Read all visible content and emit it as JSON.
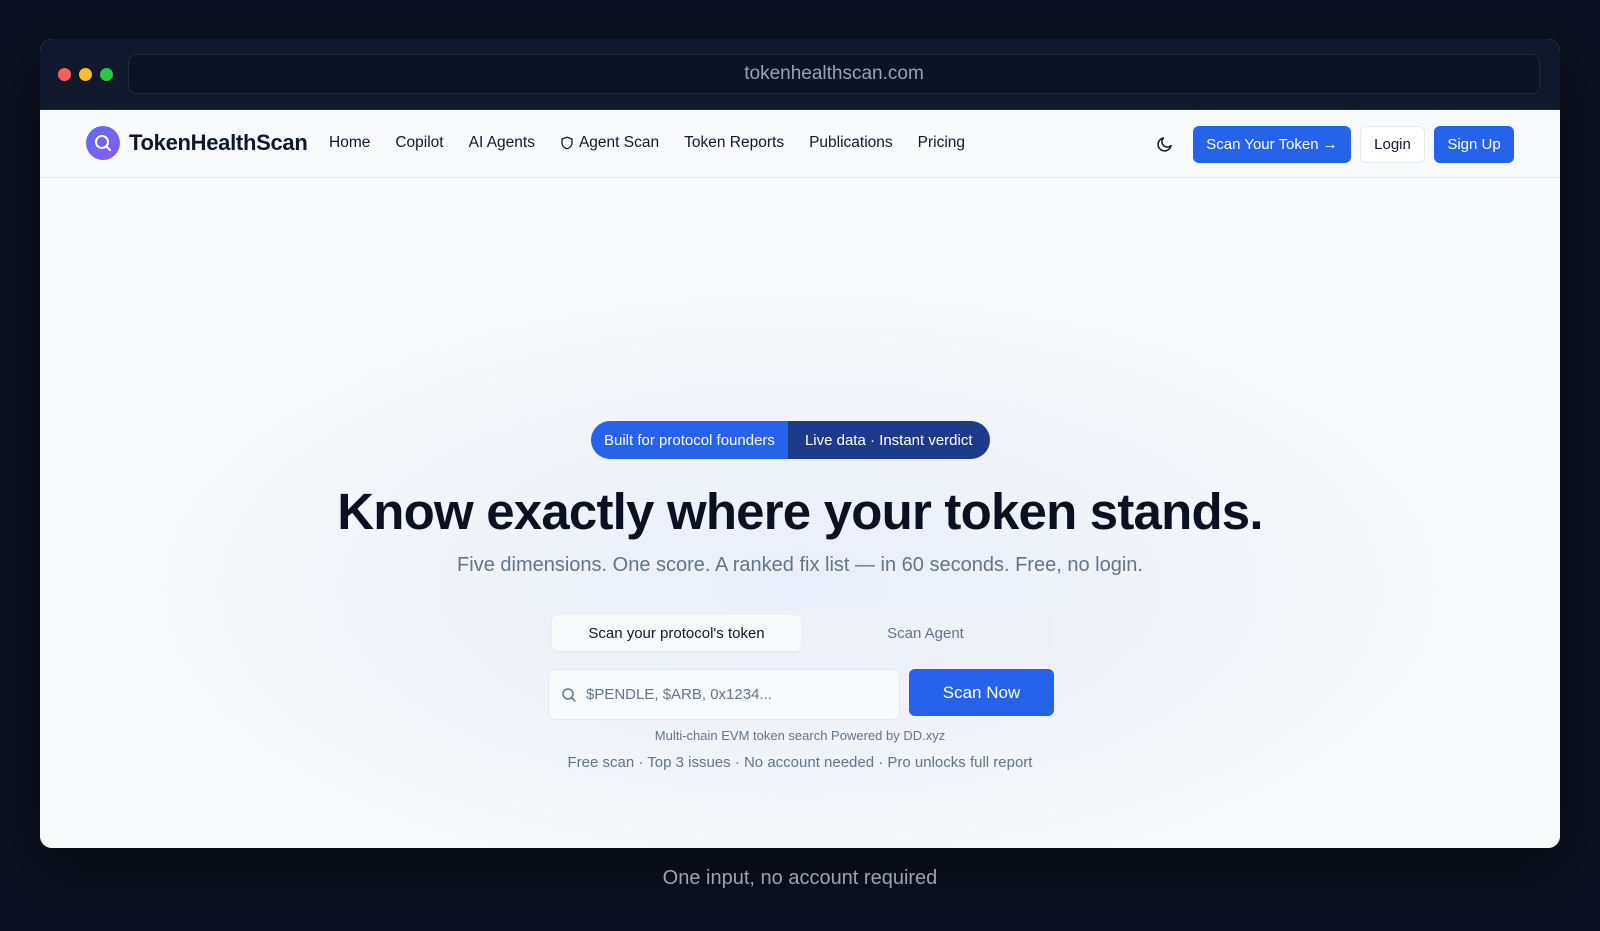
{
  "browser": {
    "url": "tokenhealthscan.com"
  },
  "nav": {
    "brand": "TokenHealthScan",
    "links": [
      "Home",
      "Copilot",
      "AI Agents",
      "Agent Scan",
      "Token Reports",
      "Publications",
      "Pricing"
    ],
    "scan_token_label": "Scan Your Token →",
    "login_label": "Login",
    "signup_label": "Sign Up"
  },
  "hero": {
    "badge_left": "Built for protocol founders",
    "badge_right": "Live data · Instant verdict",
    "headline": "Know exactly where your token stands.",
    "subhead": "Five dimensions. One score. A ranked fix list — in 60 seconds. Free, no login.",
    "tabs": [
      "Scan your protocol's token",
      "Scan Agent"
    ],
    "search_placeholder": "$PENDLE, $ARB, 0x1234...",
    "scan_now_label": "Scan Now",
    "powered_by": "Multi-chain EVM token search Powered by DD.xyz",
    "features": "Free scan · Top 3 issues · No account needed · Pro unlocks full report"
  },
  "caption": "One input, no account required",
  "colors": {
    "accent": "#2563eb",
    "accent_dark": "#1e3a8a",
    "page_bg": "#0b1120"
  },
  "icons": {
    "logo": "magnifier-icon",
    "agent_scan": "shield-icon",
    "theme": "moon-icon",
    "search": "search-icon"
  }
}
